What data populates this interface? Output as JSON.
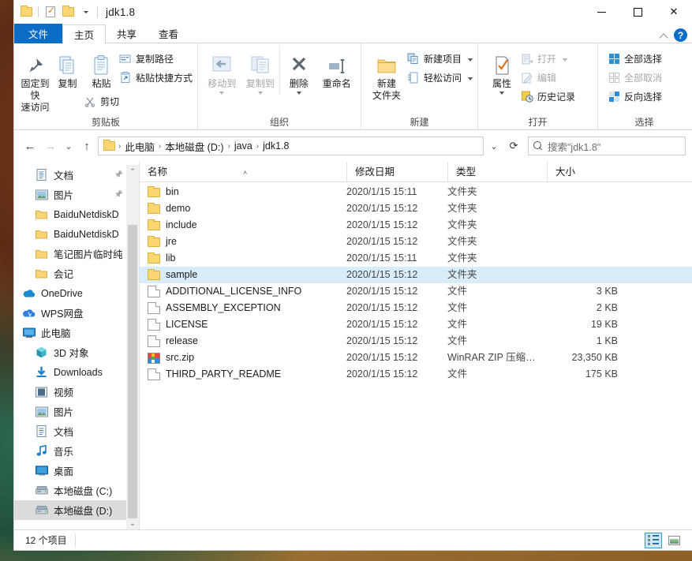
{
  "window": {
    "title": "jdk1.8",
    "quick_access": [
      "folder-icon",
      "properties-icon",
      "new-folder-icon",
      "customize-caret"
    ],
    "controls": {
      "minimize": "—",
      "maximize": "□",
      "close": "✕"
    }
  },
  "ribbon": {
    "tabs": [
      {
        "label": "文件",
        "kind": "file"
      },
      {
        "label": "主页",
        "kind": "active"
      },
      {
        "label": "共享",
        "kind": "normal"
      },
      {
        "label": "查看",
        "kind": "normal"
      }
    ],
    "collapse_icon": "chevron-up-icon",
    "help_label": "?",
    "groups": [
      {
        "caption": "剪贴板",
        "big": [
          {
            "label": "固定到快\n速访问",
            "icon": "pin-icon"
          },
          {
            "label": "复制",
            "icon": "copy-icon"
          },
          {
            "label": "粘贴",
            "icon": "paste-icon"
          }
        ],
        "small": [
          {
            "label": "复制路径",
            "icon": "copy-path-icon"
          },
          {
            "label": "粘贴快捷方式",
            "icon": "paste-shortcut-icon"
          },
          {
            "label": "剪切",
            "icon": "scissors-icon"
          }
        ]
      },
      {
        "caption": "组织",
        "big": [
          {
            "label": "移动到",
            "icon": "move-to-icon",
            "dim": true,
            "caret": true
          },
          {
            "label": "复制到",
            "icon": "copy-to-icon",
            "dim": true,
            "caret": true
          },
          {
            "label": "删除",
            "icon": "delete-icon",
            "caret": true
          },
          {
            "label": "重命名",
            "icon": "rename-icon"
          }
        ]
      },
      {
        "caption": "新建",
        "big": [
          {
            "label": "新建\n文件夹",
            "icon": "new-folder-icon"
          }
        ],
        "small": [
          {
            "label": "新建项目",
            "icon": "new-item-icon",
            "caret": true
          },
          {
            "label": "轻松访问",
            "icon": "easy-access-icon",
            "caret": true
          }
        ]
      },
      {
        "caption": "打开",
        "big": [
          {
            "label": "属性",
            "icon": "properties-icon",
            "caret": true
          }
        ],
        "small": [
          {
            "label": "打开",
            "icon": "open-icon",
            "dim": true,
            "caret": true
          },
          {
            "label": "编辑",
            "icon": "edit-icon",
            "dim": true
          },
          {
            "label": "历史记录",
            "icon": "history-icon"
          }
        ]
      },
      {
        "caption": "选择",
        "small": [
          {
            "label": "全部选择",
            "icon": "select-all-icon"
          },
          {
            "label": "全部取消",
            "icon": "select-none-icon",
            "dim": true
          },
          {
            "label": "反向选择",
            "icon": "invert-selection-icon"
          }
        ]
      }
    ]
  },
  "address": {
    "back_icon": "arrow-left-icon",
    "forward_icon": "arrow-right-icon",
    "recent_icon": "chevron-down-icon",
    "up_icon": "arrow-up-icon",
    "crumbs": [
      "此电脑",
      "本地磁盘 (D:)",
      "java",
      "jdk1.8"
    ],
    "separator": "›",
    "dropdown_icon": "chevron-down-icon",
    "refresh_icon": "refresh-icon",
    "search_icon": "search-icon",
    "search_placeholder": "搜索\"jdk1.8\""
  },
  "navpane": {
    "items": [
      {
        "label": "文档",
        "icon": "documents-icon",
        "indent": 2,
        "pinned": true
      },
      {
        "label": "图片",
        "icon": "pictures-icon",
        "indent": 2,
        "pinned": true
      },
      {
        "label": "BaiduNetdiskD",
        "icon": "folder-icon",
        "indent": 2
      },
      {
        "label": "BaiduNetdiskD",
        "icon": "folder-icon",
        "indent": 2
      },
      {
        "label": "笔记图片临时纯",
        "icon": "folder-icon",
        "indent": 2
      },
      {
        "label": "会记",
        "icon": "folder-icon",
        "indent": 2
      },
      {
        "label": "OneDrive",
        "icon": "onedrive-icon",
        "indent": 1
      },
      {
        "label": "WPS网盘",
        "icon": "wps-cloud-icon",
        "indent": 1
      },
      {
        "label": "此电脑",
        "icon": "this-pc-icon",
        "indent": 1
      },
      {
        "label": "3D 对象",
        "icon": "3d-objects-icon",
        "indent": 2
      },
      {
        "label": "Downloads",
        "icon": "downloads-icon",
        "indent": 2
      },
      {
        "label": "视频",
        "icon": "videos-icon",
        "indent": 2
      },
      {
        "label": "图片",
        "icon": "pictures-icon",
        "indent": 2
      },
      {
        "label": "文档",
        "icon": "documents-icon",
        "indent": 2
      },
      {
        "label": "音乐",
        "icon": "music-icon",
        "indent": 2
      },
      {
        "label": "桌面",
        "icon": "desktop-icon",
        "indent": 2
      },
      {
        "label": "本地磁盘 (C:)",
        "icon": "local-disk-icon",
        "indent": 2
      },
      {
        "label": "本地磁盘 (D:)",
        "icon": "local-disk-icon",
        "indent": 2,
        "selected": true
      }
    ],
    "scroll_up_icon": "chevron-up-icon",
    "scroll_down_icon": "chevron-down-icon"
  },
  "filelist": {
    "columns": [
      {
        "label": "名称",
        "key": "name",
        "sorted": true,
        "sort_glyph": "˄"
      },
      {
        "label": "修改日期",
        "key": "date"
      },
      {
        "label": "类型",
        "key": "type"
      },
      {
        "label": "大小",
        "key": "size"
      }
    ],
    "rows": [
      {
        "name": "bin",
        "date": "2020/1/15 15:11",
        "type": "文件夹",
        "size": "",
        "icon": "folder"
      },
      {
        "name": "demo",
        "date": "2020/1/15 15:12",
        "type": "文件夹",
        "size": "",
        "icon": "folder"
      },
      {
        "name": "include",
        "date": "2020/1/15 15:12",
        "type": "文件夹",
        "size": "",
        "icon": "folder"
      },
      {
        "name": "jre",
        "date": "2020/1/15 15:12",
        "type": "文件夹",
        "size": "",
        "icon": "folder"
      },
      {
        "name": "lib",
        "date": "2020/1/15 15:11",
        "type": "文件夹",
        "size": "",
        "icon": "folder"
      },
      {
        "name": "sample",
        "date": "2020/1/15 15:12",
        "type": "文件夹",
        "size": "",
        "icon": "folder",
        "selected": true
      },
      {
        "name": "ADDITIONAL_LICENSE_INFO",
        "date": "2020/1/15 15:12",
        "type": "文件",
        "size": "3 KB",
        "icon": "file"
      },
      {
        "name": "ASSEMBLY_EXCEPTION",
        "date": "2020/1/15 15:12",
        "type": "文件",
        "size": "2 KB",
        "icon": "file"
      },
      {
        "name": "LICENSE",
        "date": "2020/1/15 15:12",
        "type": "文件",
        "size": "19 KB",
        "icon": "file"
      },
      {
        "name": "release",
        "date": "2020/1/15 15:12",
        "type": "文件",
        "size": "1 KB",
        "icon": "file"
      },
      {
        "name": "src.zip",
        "date": "2020/1/15 15:12",
        "type": "WinRAR ZIP 压缩…",
        "size": "23,350 KB",
        "icon": "zip"
      },
      {
        "name": "THIRD_PARTY_README",
        "date": "2020/1/15 15:12",
        "type": "文件",
        "size": "175 KB",
        "icon": "file"
      }
    ]
  },
  "statusbar": {
    "item_count": "12 个项目",
    "details_view_icon": "details-view-icon",
    "thumbnail_view_icon": "thumbnail-view-icon"
  },
  "colors": {
    "accent": "#0b6ec6",
    "selection": "#d9ecf9",
    "nav_selection": "#dcdcdc",
    "folder": "#fcd670"
  }
}
